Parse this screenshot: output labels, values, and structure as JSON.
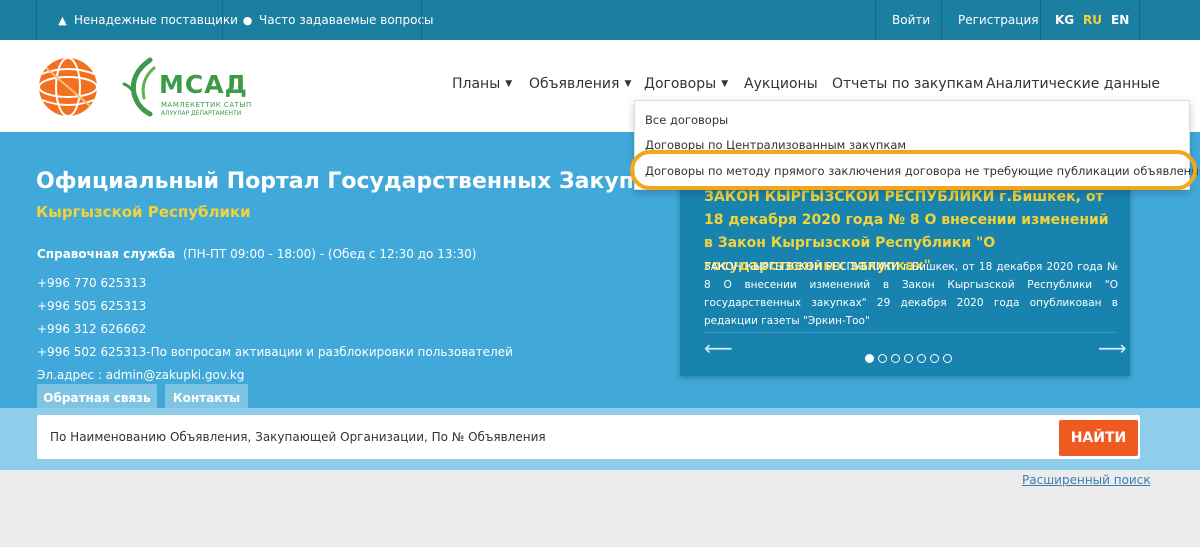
{
  "topbar": {
    "left_items": [
      {
        "icon": "warning-icon",
        "label": "Ненадежные поставщики"
      },
      {
        "icon": "question-circle-icon",
        "label": "Часто задаваемые вопросы"
      }
    ],
    "login": "Войти",
    "register": "Регистрация",
    "languages": [
      "KG",
      "RU",
      "EN"
    ],
    "active_language": "RU"
  },
  "header": {
    "logo_text": "МСАД",
    "logo_sub1": "МАМЛЕКЕТТИК САТЫП",
    "logo_sub2": "АЛУУЛАР ДЕПАРТАМЕНТИ",
    "nav": [
      {
        "label": "Планы",
        "dropdown": true
      },
      {
        "label": "Объявления",
        "dropdown": true
      },
      {
        "label": "Договоры",
        "dropdown": true
      },
      {
        "label": "Аукционы",
        "dropdown": false
      },
      {
        "label": "Отчеты по закупкам",
        "dropdown": false
      },
      {
        "label": "Аналитические данные",
        "dropdown": false
      }
    ]
  },
  "dropdown": {
    "items": [
      "Все договоры",
      "Договоры по Централизованным закупкам",
      "Договоры по методу прямого заключения договора не требующие публикации объявления"
    ]
  },
  "hero": {
    "title": "Официальный Портал Государственных Закупок",
    "subtitle": "Кыргызской Республики",
    "help_label": "Справочная служба",
    "help_hours": "(ПН-ПТ 09:00 - 18:00) - (Обед с 12:30 до 13:30)",
    "contacts": [
      "+996 770 625313",
      "+996 505 625313",
      "+996 312 626662",
      "+996 502 625313-По вопросам активации и разблокировки пользователей",
      "Эл.адрес : admin@zakupki.gov.kg"
    ],
    "tabs": [
      "Обратная связь",
      "Контакты"
    ]
  },
  "news": {
    "title": "ЗАКОН КЫРГЫЗСКОЙ РЕСПУБЛИКИ г.Бишкек, от 18 декабря 2020 года № 8 О внесении изменений в Закон Кыргызской Республики \"О государственных закупках\"",
    "body": "ЗАКОН КЫРГЫЗСКОЙ РЕСПУБЛИКИ г.Бишкек, от 18 декабря 2020 года № 8 О внесении изменений в Закон Кыргызской Республики \"О государственных закупках\" 29 декабря 2020 года опубликован в редакции газеты \"Эркин-Тоо\"",
    "prev_icon": "arrow-left-icon",
    "next_icon": "arrow-right-icon",
    "slides_total": 7,
    "active_slide": 1
  },
  "search": {
    "placeholder": "По Наименованию Объявления,  Закупающей Организации, По № Объявления",
    "button": "НАЙТИ",
    "advanced": "Расширенный поиск"
  },
  "colors": {
    "topbar": "#1a7fa0",
    "hero": "#41a9d9",
    "news": "#1783ae",
    "accent_yellow": "#f2d33a",
    "search_button": "#ee5a1f",
    "highlight": "#f4a61b"
  }
}
